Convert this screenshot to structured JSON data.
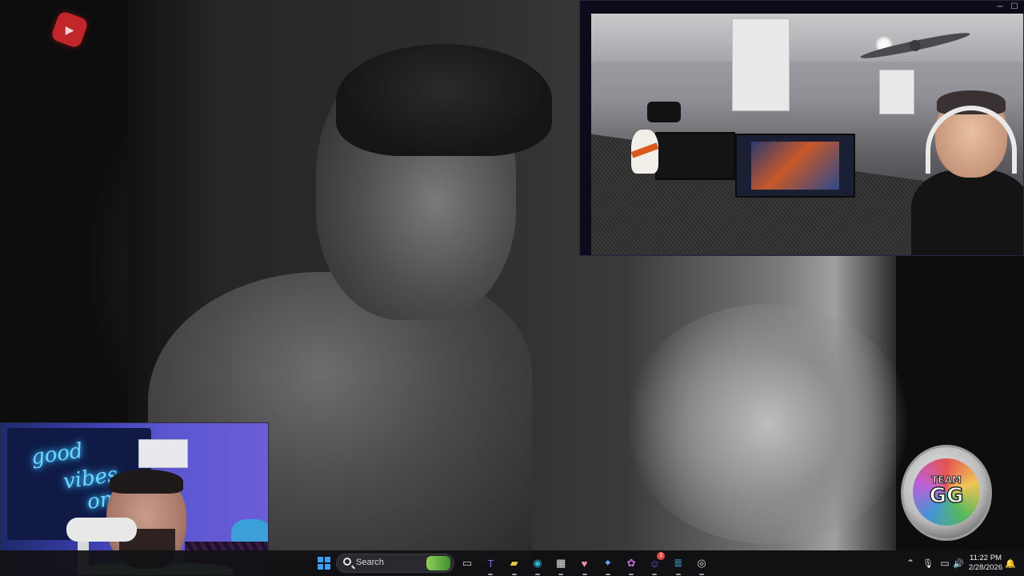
{
  "window": {
    "minimize_glyph": "─",
    "close_glyph": "☐"
  },
  "taskbar": {
    "search_placeholder": "Search",
    "apps": [
      {
        "name": "task-view-icon",
        "glyph": "▭",
        "color": "#cfcfcf"
      },
      {
        "name": "teams-icon",
        "glyph": "T",
        "color": "#6b6fd6"
      },
      {
        "name": "file-explorer-icon",
        "glyph": "▰",
        "color": "#f2c64a"
      },
      {
        "name": "edge-icon",
        "glyph": "◉",
        "color": "#2fb3d9"
      },
      {
        "name": "store-icon",
        "glyph": "▦",
        "color": "#e8e8e8"
      },
      {
        "name": "pinned-app-icon",
        "glyph": "♥",
        "color": "#f28cb0"
      },
      {
        "name": "copilot-icon",
        "glyph": "✦",
        "color": "#6aa8ff"
      },
      {
        "name": "game-icon",
        "glyph": "✿",
        "color": "#c86ad8"
      },
      {
        "name": "discord-icon",
        "glyph": "☺",
        "color": "#5865f2"
      },
      {
        "name": "notepad-icon",
        "glyph": "≣",
        "color": "#4fb6e8"
      },
      {
        "name": "obs-icon",
        "glyph": "◎",
        "color": "#d8d8d8"
      }
    ],
    "discord_badge": "2",
    "tray": {
      "chevron": "⌃",
      "mic": "🎙",
      "network": "▭",
      "volume": "🔊",
      "notification": "🔔"
    },
    "time": "11:22 PM",
    "date": "2/28/2026"
  },
  "logo": {
    "line1": "TEAM",
    "line2": "GG"
  },
  "neon_sign": {
    "line1": "good",
    "line2": "vibes",
    "line3": "on"
  },
  "colors": {
    "youtube_red": "#c0262a",
    "taskbar_bg": "#121214",
    "neon_blue": "#6fd6ff"
  }
}
